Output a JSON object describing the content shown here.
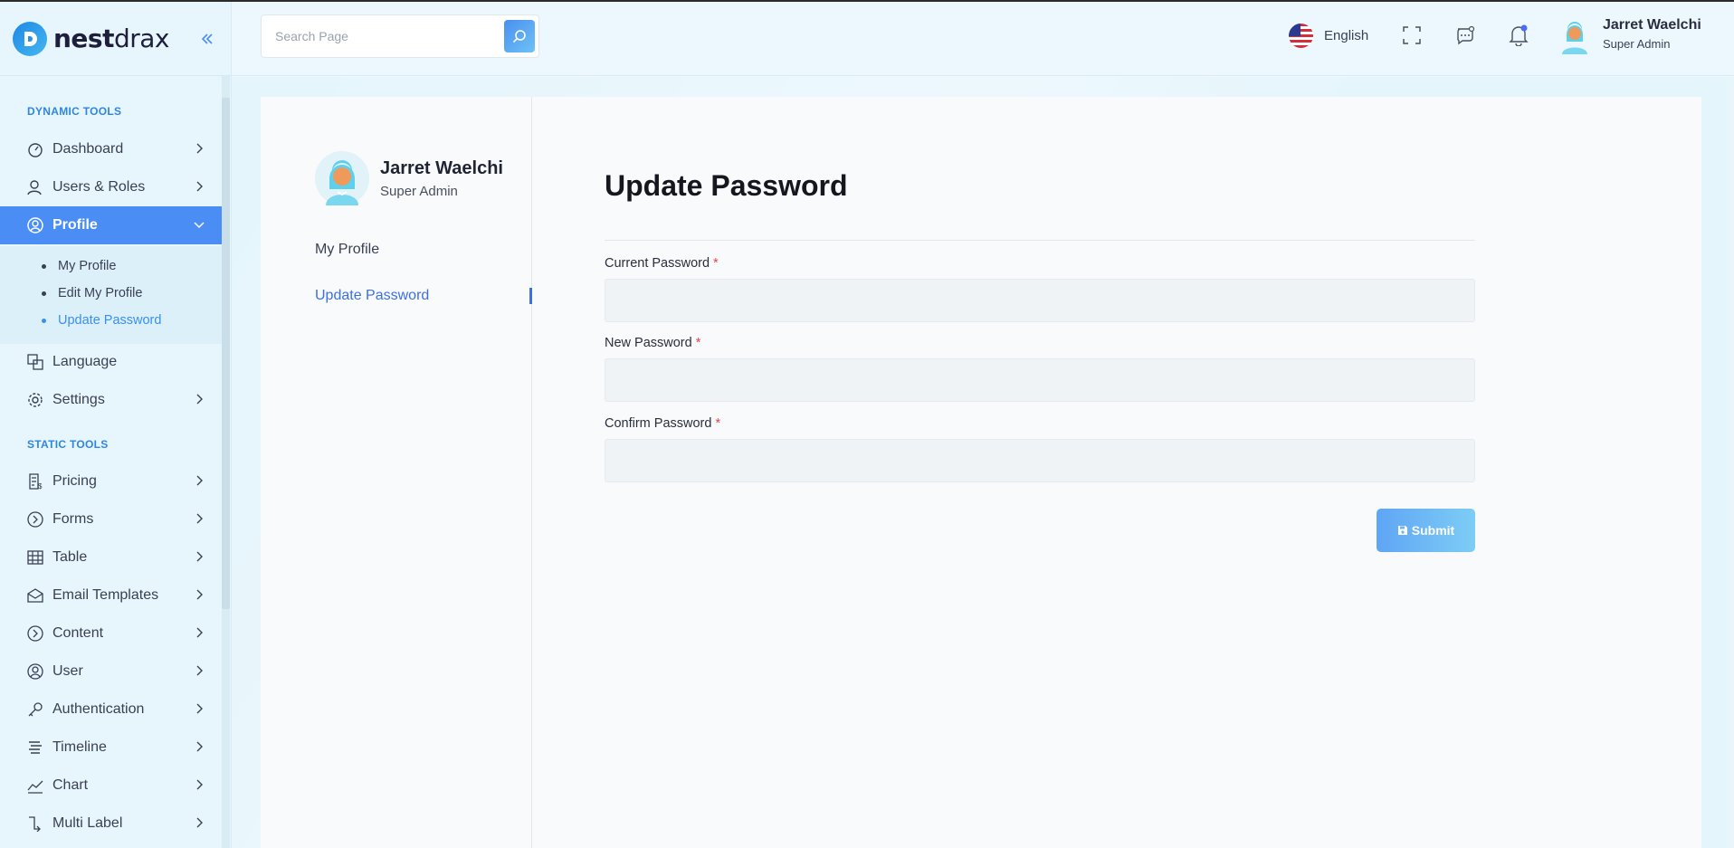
{
  "brand": {
    "name_bold": "nest",
    "name_light": "drax"
  },
  "header": {
    "search_placeholder": "Search Page",
    "language": "English",
    "user_name": "Jarret Waelchi",
    "user_role": "Super Admin"
  },
  "sidebar": {
    "dynamic_label": "DYNAMIC TOOLS",
    "static_label": "STATIC TOOLS",
    "dynamic_items": [
      {
        "label": "Dashboard",
        "icon": "dashboard-icon"
      },
      {
        "label": "Users & Roles",
        "icon": "user-icon"
      },
      {
        "label": "Profile",
        "icon": "profile-icon"
      },
      {
        "label": "Language",
        "icon": "language-icon"
      },
      {
        "label": "Settings",
        "icon": "gear-icon"
      }
    ],
    "profile_submenu": [
      "My Profile",
      "Edit My Profile",
      "Update Password"
    ],
    "static_items": [
      {
        "label": "Pricing",
        "icon": "pricing-icon"
      },
      {
        "label": "Forms",
        "icon": "forms-icon"
      },
      {
        "label": "Table",
        "icon": "table-icon"
      },
      {
        "label": "Email Templates",
        "icon": "email-icon"
      },
      {
        "label": "Content",
        "icon": "content-icon"
      },
      {
        "label": "User",
        "icon": "user-circle-icon"
      },
      {
        "label": "Authentication",
        "icon": "key-icon"
      },
      {
        "label": "Timeline",
        "icon": "timeline-icon"
      },
      {
        "label": "Chart",
        "icon": "chart-icon"
      },
      {
        "label": "Multi Label",
        "icon": "multi-label-icon"
      }
    ]
  },
  "profile_card": {
    "name": "Jarret Waelchi",
    "role": "Super Admin",
    "links": [
      "My Profile",
      "Update Password"
    ]
  },
  "form": {
    "title": "Update Password",
    "fields": [
      {
        "label": "Current Password",
        "required": "*",
        "value": ""
      },
      {
        "label": "New Password",
        "required": "*",
        "value": ""
      },
      {
        "label": "Confirm Password",
        "required": "*",
        "value": ""
      }
    ],
    "submit_label": "Submit"
  },
  "colors": {
    "accent": "#4a8ef5",
    "link_active": "#3b6fe8",
    "required": "#e04848"
  }
}
